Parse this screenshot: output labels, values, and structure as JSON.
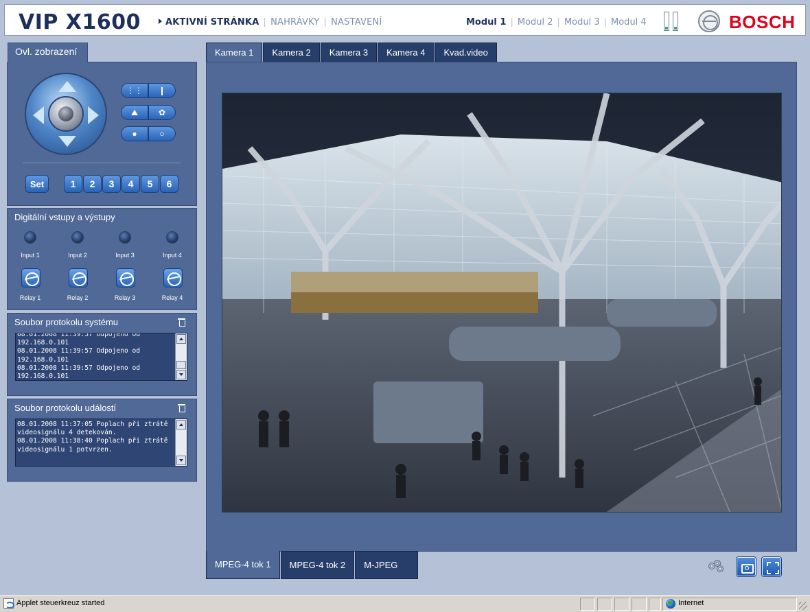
{
  "header": {
    "title": "VIP X1600",
    "nav": [
      {
        "label": "AKTIVNÍ STRÁNKA",
        "active": true
      },
      {
        "label": "NAHRÁVKY",
        "active": false
      },
      {
        "label": "NASTAVENÍ",
        "active": false
      }
    ],
    "modules": [
      {
        "label": "Modul 1",
        "active": true
      },
      {
        "label": "Modul 2",
        "active": false
      },
      {
        "label": "Modul 3",
        "active": false
      },
      {
        "label": "Modul 4",
        "active": false
      }
    ],
    "brand": "BOSCH"
  },
  "sidebar": {
    "view_control_tab": "Ovl. zobrazení",
    "ptz": {
      "set_label": "Set",
      "presets": [
        "1",
        "2",
        "3",
        "4",
        "5",
        "6"
      ],
      "lens_buttons": [
        {
          "name": "zoom-out-button",
          "icon": "zoom-out-icon",
          "glyph": "⋮⋮"
        },
        {
          "name": "zoom-in-button",
          "icon": "zoom-in-icon",
          "glyph": "❙"
        },
        {
          "name": "focus-far-button",
          "icon": "focus-far-icon",
          "glyph": "⛰"
        },
        {
          "name": "focus-near-button",
          "icon": "focus-near-icon",
          "glyph": "✿"
        },
        {
          "name": "iris-close-button",
          "icon": "iris-close-icon",
          "glyph": "●"
        },
        {
          "name": "iris-open-button",
          "icon": "iris-open-icon",
          "glyph": "○"
        }
      ]
    },
    "io": {
      "title": "Digitální vstupy a výstupy",
      "inputs": [
        "Input 1",
        "Input 2",
        "Input 3",
        "Input 4"
      ],
      "relays": [
        "Relay 1",
        "Relay 2",
        "Relay 3",
        "Relay 4"
      ]
    },
    "system_log": {
      "title": "Soubor protokolu systému",
      "text": "08.01.2008 11:39:57 Odpojeno od\n192.168.0.101\n08.01.2008 11:39:57 Odpojeno od\n192.168.0.101\n08.01.2008 11:39:57 Odpojeno od\n192.168.0.101"
    },
    "event_log": {
      "title": "Soubor protokolu událostí",
      "text": "08.01.2008 11:37:05 Poplach při ztrátě\nvideosignálu 4 detekován.\n08.01.2008 11:38:40 Poplach při ztrátě\nvideosignálu 1 potvrzen."
    }
  },
  "camera": {
    "tabs": [
      {
        "label": "Kamera 1",
        "active": true
      },
      {
        "label": "Kamera 2",
        "active": false
      },
      {
        "label": "Kamera 3",
        "active": false
      },
      {
        "label": "Kamera 4",
        "active": false
      },
      {
        "label": "Kvad.video",
        "active": false
      }
    ],
    "streams": [
      {
        "label": "MPEG-4 tok 1",
        "active": true
      },
      {
        "label": "MPEG-4 tok 2",
        "active": false
      },
      {
        "label": "M-JPEG",
        "active": false
      }
    ],
    "controls": [
      "record-icon",
      "snapshot-icon",
      "fullscreen-icon"
    ]
  },
  "statusbar": {
    "text": "Applet steuerkreuz started",
    "zone": "Internet"
  },
  "colors": {
    "panel": "#506996",
    "tab_inactive": "#283e6a",
    "title": "#1e2f5c",
    "brand_red": "#e2001a",
    "background": "#b4c1d7"
  }
}
